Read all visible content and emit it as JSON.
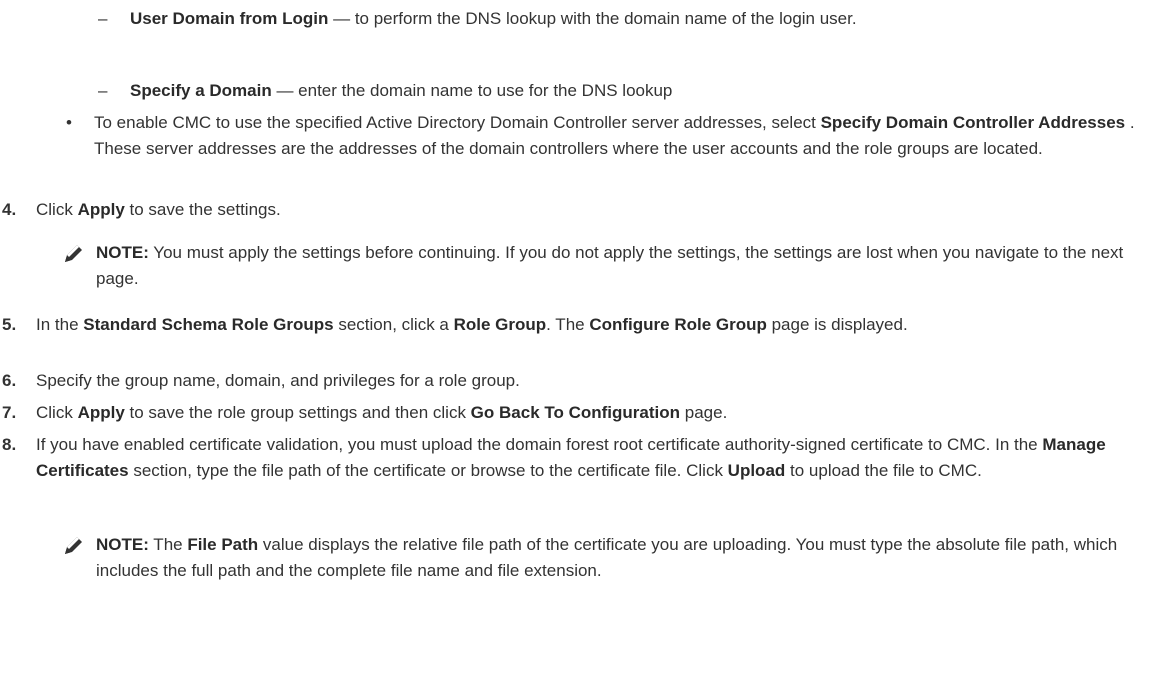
{
  "list": {
    "dash_1": {
      "bold": "User Domain from Login",
      "sep": " — ",
      "text": "to perform the DNS lookup with the domain name of the login user."
    },
    "dash_2": {
      "bold": "Specify a Domain",
      "sep": " — ",
      "text": "enter the domain name to use for the DNS lookup"
    },
    "bullet_1": {
      "t1": "To enable CMC to use the specified Active Directory Domain Controller server addresses, select ",
      "b1": "Specify Domain Controller Addresses",
      "t2": " . These server addresses are the addresses of the domain controllers where the user accounts and the role groups are located."
    }
  },
  "steps": [
    {
      "num": "4.",
      "t1": "Click ",
      "b1": "Apply",
      "t2": " to save the settings."
    },
    {
      "num": "5.",
      "t1": "In the ",
      "b1": "Standard Schema Role Groups",
      "t2": " section, click a ",
      "b2": "Role Group",
      "t3": ". The ",
      "b3": "Configure Role Group",
      "t4": " page is displayed."
    },
    {
      "num": "6.",
      "t1": "Specify the group name, domain, and privileges for a role group."
    },
    {
      "num": "7.",
      "t1": "Click ",
      "b1": "Apply",
      "t2": " to save the role group settings and then click ",
      "b2": "Go Back To Configuration",
      "t3": " page."
    },
    {
      "num": "8.",
      "t1": "If you have enabled certificate validation, you must upload the domain forest root certificate authority-signed certificate to CMC. In the ",
      "b1": "Manage Certificates",
      "t2": " section, type the file path of the certificate or browse to the certificate file. Click ",
      "b2": "Upload",
      "t3": " to upload the file to CMC."
    }
  ],
  "notes": [
    {
      "label": "NOTE:",
      "t1": " You must apply the settings before continuing. If you do not apply the settings, the settings are lost when you navigate to the next page."
    },
    {
      "label": "NOTE:",
      "t1": " The ",
      "b1": "File Path",
      "t2": " value displays the relative file path of the certificate you are uploading. You must type the absolute file path, which includes the full path and the complete file name and file extension."
    }
  ],
  "symbols": {
    "dash": "–",
    "bullet": "•"
  },
  "icons": {
    "note": "pencil-note-icon"
  }
}
